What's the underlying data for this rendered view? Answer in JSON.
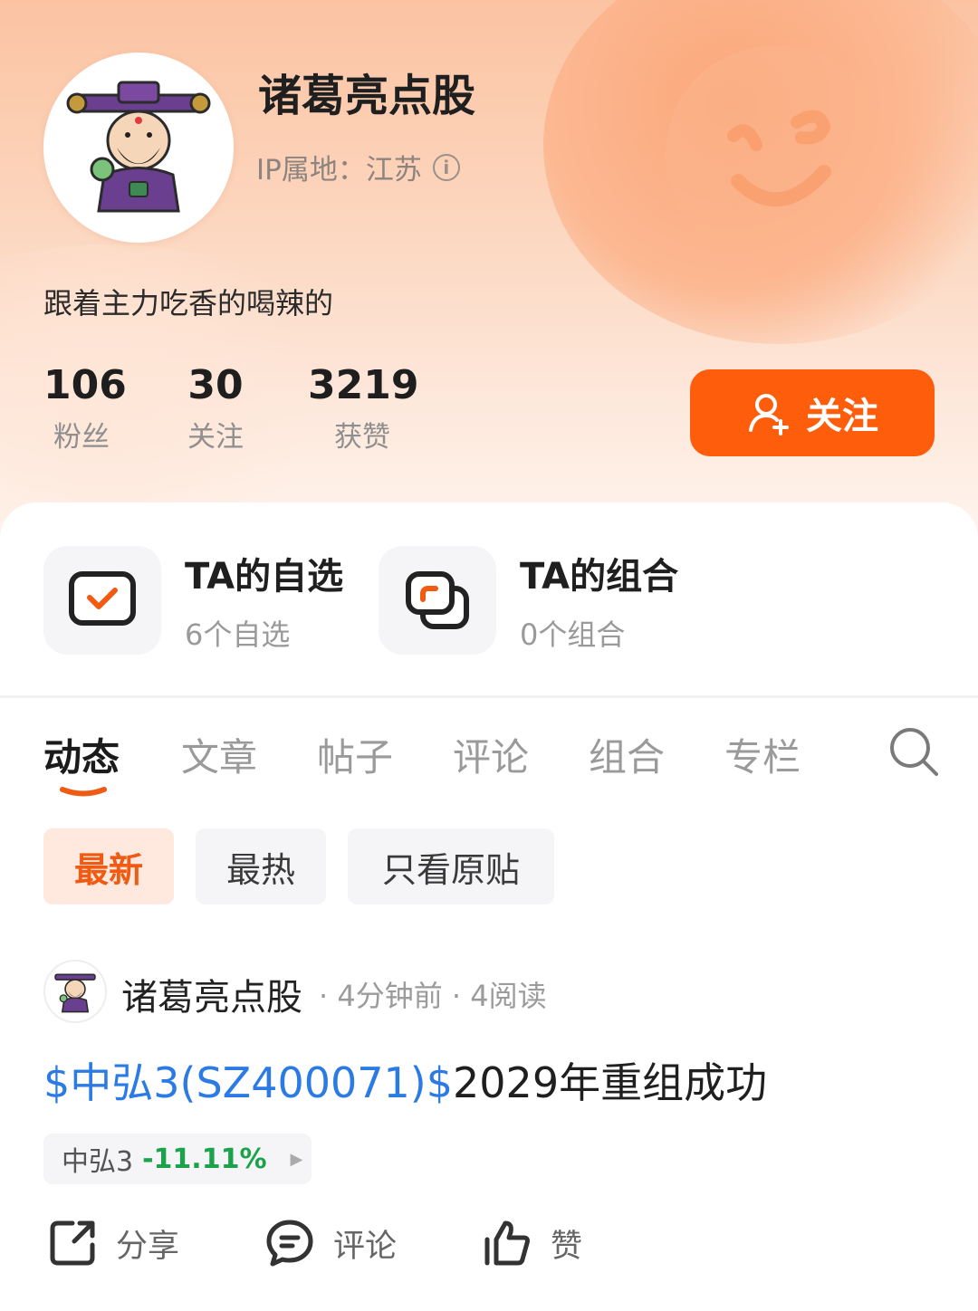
{
  "profile": {
    "username": "诸葛亮点股",
    "ip_label": "IP属地：江苏",
    "bio": "跟着主力吃香的喝辣的",
    "stats": [
      {
        "value": "106",
        "label": "粉丝"
      },
      {
        "value": "30",
        "label": "关注"
      },
      {
        "value": "3219",
        "label": "获赞"
      }
    ],
    "follow_label": "关注"
  },
  "features": [
    {
      "title": "TA的自选",
      "sub": "6个自选",
      "icon": "watchlist-icon"
    },
    {
      "title": "TA的组合",
      "sub": "0个组合",
      "icon": "portfolio-icon"
    }
  ],
  "tabs": [
    "动态",
    "文章",
    "帖子",
    "评论",
    "组合",
    "专栏"
  ],
  "active_tab": "动态",
  "filters": [
    "最新",
    "最热",
    "只看原贴"
  ],
  "active_filter": "最新",
  "post": {
    "author": "诸葛亮点股",
    "meta": "· 4分钟前 · 4阅读",
    "stock_link": "$中弘3(SZ400071)$",
    "text": "2029年重组成功",
    "stock_chip": {
      "name": "中弘3",
      "change": "-11.11%"
    },
    "actions": [
      {
        "label": "分享",
        "icon": "share-icon"
      },
      {
        "label": "评论",
        "icon": "comment-icon"
      },
      {
        "label": "赞",
        "icon": "like-icon"
      }
    ]
  },
  "colors": {
    "accent": "#fe5d0c",
    "link": "#2c7be5",
    "down": "#1aa34a"
  }
}
